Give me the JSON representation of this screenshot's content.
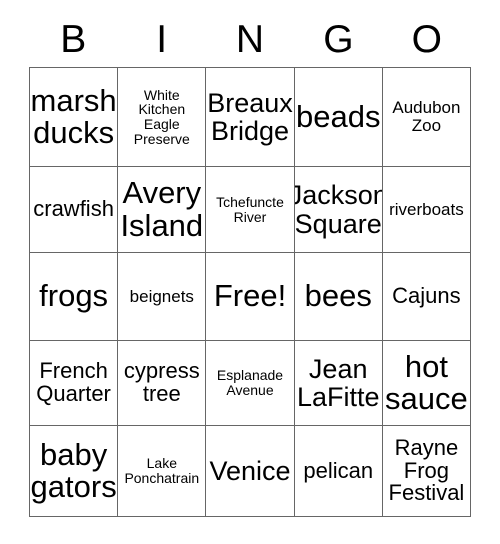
{
  "card": {
    "headers": [
      "B",
      "I",
      "N",
      "G",
      "O"
    ],
    "rows": [
      [
        {
          "text": "marsh ducks",
          "size": "xl"
        },
        {
          "text": "White Kitchen Eagle Preserve",
          "size": "xs"
        },
        {
          "text": "Breaux Bridge",
          "size": "lg"
        },
        {
          "text": "beads",
          "size": "xl"
        },
        {
          "text": "Audubon Zoo",
          "size": "sm"
        }
      ],
      [
        {
          "text": "crawfish",
          "size": "md"
        },
        {
          "text": "Avery Island",
          "size": "xl"
        },
        {
          "text": "Tchefuncte River",
          "size": "xs"
        },
        {
          "text": "Jackson Square",
          "size": "lg"
        },
        {
          "text": "riverboats",
          "size": "sm"
        }
      ],
      [
        {
          "text": "frogs",
          "size": "xl"
        },
        {
          "text": "beignets",
          "size": "sm"
        },
        {
          "text": "Free!",
          "size": "xl"
        },
        {
          "text": "bees",
          "size": "xl"
        },
        {
          "text": "Cajuns",
          "size": "md"
        }
      ],
      [
        {
          "text": "French Quarter",
          "size": "md"
        },
        {
          "text": "cypress tree",
          "size": "md"
        },
        {
          "text": "Esplanade Avenue",
          "size": "xs"
        },
        {
          "text": "Jean LaFitte",
          "size": "lg"
        },
        {
          "text": "hot sauce",
          "size": "xl"
        }
      ],
      [
        {
          "text": "baby gators",
          "size": "xl"
        },
        {
          "text": "Lake Ponchatrain",
          "size": "xs"
        },
        {
          "text": "Venice",
          "size": "lg"
        },
        {
          "text": "pelican",
          "size": "md"
        },
        {
          "text": "Rayne Frog Festival",
          "size": "md"
        }
      ]
    ]
  },
  "colors": {
    "grid_line": "#666666",
    "text": "#000000",
    "background": "#ffffff"
  }
}
